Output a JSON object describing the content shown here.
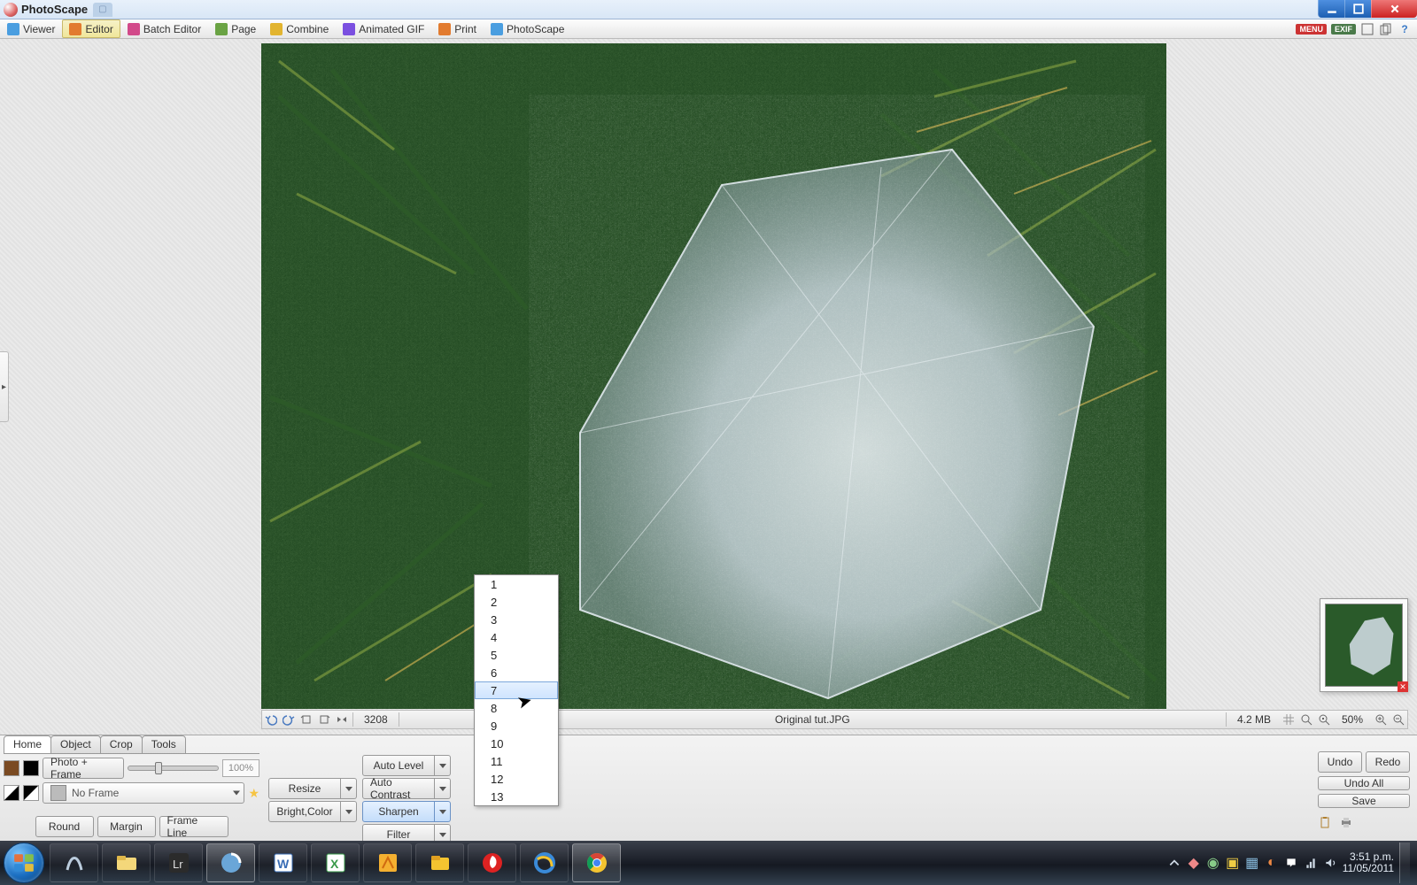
{
  "window": {
    "title": "PhotoScape"
  },
  "modules": {
    "items": [
      {
        "label": "Viewer"
      },
      {
        "label": "Editor"
      },
      {
        "label": "Batch Editor"
      },
      {
        "label": "Page"
      },
      {
        "label": "Combine"
      },
      {
        "label": "Animated GIF"
      },
      {
        "label": "Print"
      },
      {
        "label": "PhotoScape"
      }
    ],
    "active": "Editor",
    "right": {
      "menu_badge": "MENU",
      "exif_badge": "EXIF"
    }
  },
  "status": {
    "dim": "3208",
    "filename": "Original tut.JPG",
    "filesize": "4.2 MB",
    "zoom": "50%"
  },
  "popup": {
    "items": [
      "1",
      "2",
      "3",
      "4",
      "5",
      "6",
      "7",
      "8",
      "9",
      "10",
      "11",
      "12",
      "13"
    ],
    "highlight": "7"
  },
  "tabs": {
    "items": [
      "Home",
      "Object",
      "Crop",
      "Tools"
    ],
    "active": "Home"
  },
  "home": {
    "photo_frame": "Photo + Frame",
    "opacity": "100%",
    "no_frame": "No Frame",
    "round": "Round",
    "margin": "Margin",
    "frame_line": "Frame Line",
    "resize": "Resize",
    "bright_color": "Bright,Color",
    "auto_level": "Auto Level",
    "auto_contrast": "Auto Contrast",
    "sharpen": "Sharpen",
    "filter": "Filter"
  },
  "right_actions": {
    "undo": "Undo",
    "redo": "Redo",
    "undo_all": "Undo All",
    "save": "Save"
  },
  "taskbar": {
    "time": "3:51 p.m.",
    "date": "11/05/2011"
  }
}
